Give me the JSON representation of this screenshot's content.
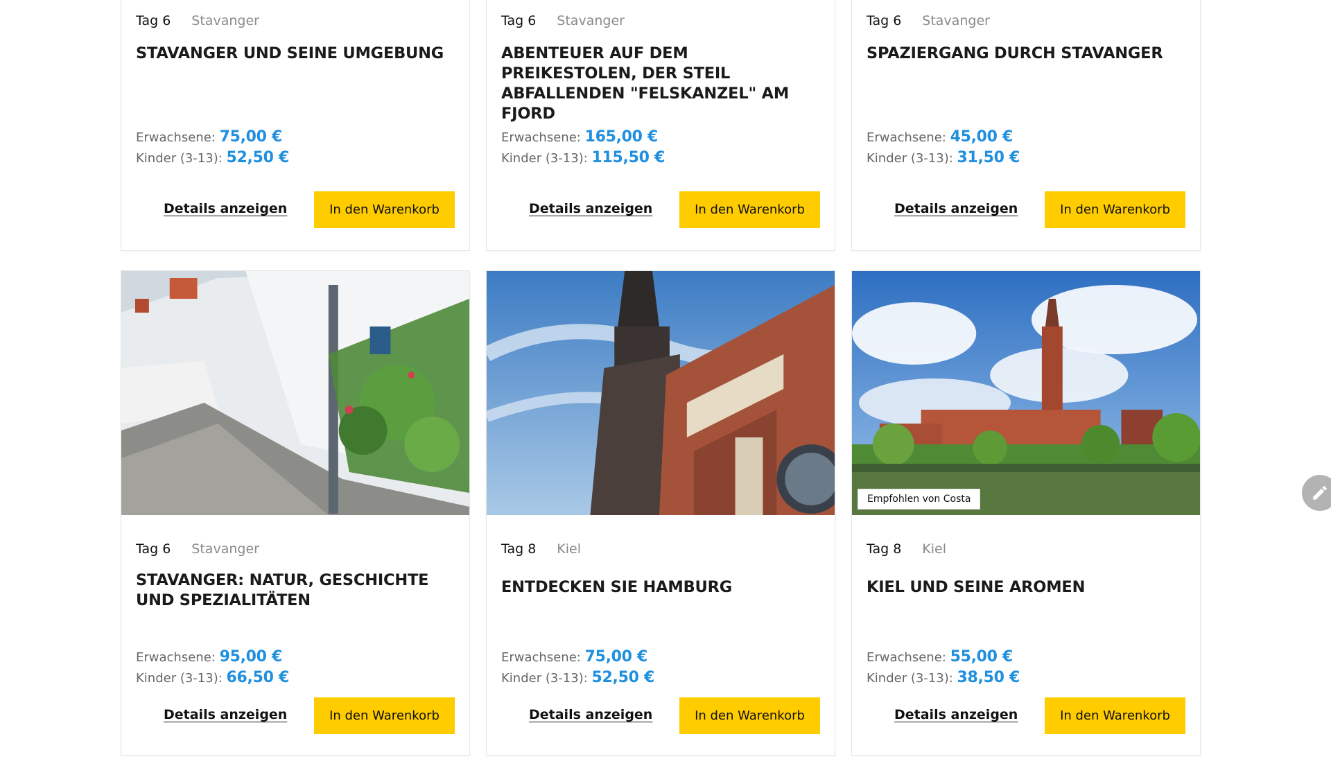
{
  "labels": {
    "adults": "Erwachsene:",
    "children": "Kinder (3-13):",
    "details": "Details anzeigen",
    "cart": "In den Warenkorb"
  },
  "cards": [
    {
      "day": "Tag 6",
      "port": "Stavanger",
      "title": "STAVANGER UND SEINE UMGEBUNG",
      "adult_price": "75,00 €",
      "child_price": "52,50 €"
    },
    {
      "day": "Tag 6",
      "port": "Stavanger",
      "title": "ABENTEUER AUF DEM PREIKESTOLEN, DER STEIL ABFALLENDEN \"FELSKANZEL\" AM FJORD",
      "adult_price": "165,00 €",
      "child_price": "115,50 €"
    },
    {
      "day": "Tag 6",
      "port": "Stavanger",
      "title": "SPAZIERGANG DURCH STAVANGER",
      "adult_price": "45,00 €",
      "child_price": "31,50 €"
    },
    {
      "day": "Tag 6",
      "port": "Stavanger",
      "title": "STAVANGER: NATUR, GESCHICHTE UND SPEZIALITÄTEN",
      "adult_price": "95,00 €",
      "child_price": "66,50 €"
    },
    {
      "day": "Tag 8",
      "port": "Kiel",
      "title": "ENTDECKEN SIE HAMBURG",
      "adult_price": "75,00 €",
      "child_price": "52,50 €"
    },
    {
      "day": "Tag 8",
      "port": "Kiel",
      "title": "KIEL UND SEINE AROMEN",
      "adult_price": "55,00 €",
      "child_price": "38,50 €",
      "badge": "Empfohlen von Costa"
    }
  ],
  "colors": {
    "price": "#1f8fde",
    "cart_button": "#ffcc00"
  },
  "icons": {
    "fab": "pencil-icon"
  }
}
